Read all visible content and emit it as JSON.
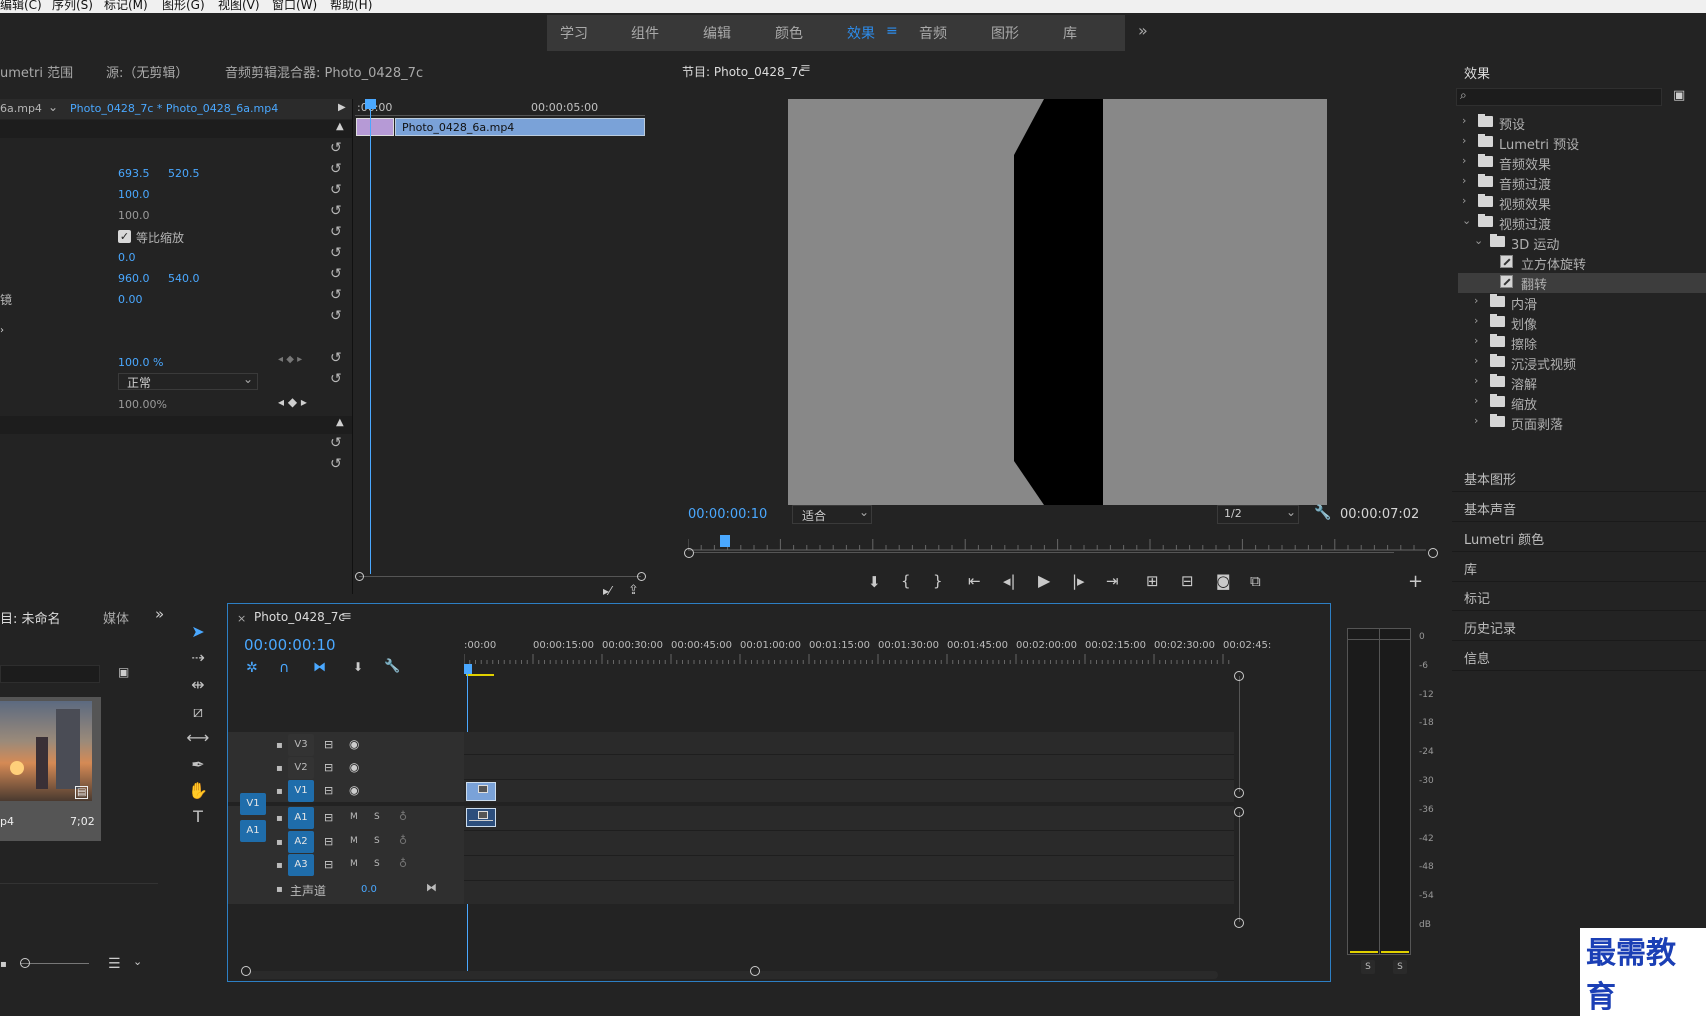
{
  "menu": [
    "编辑(C)",
    "序列(S)",
    "标记(M)",
    "图形(G)",
    "视图(V)",
    "窗口(W)",
    "帮助(H)"
  ],
  "workspaces": [
    {
      "label": "学习",
      "active": false
    },
    {
      "label": "组件",
      "active": false
    },
    {
      "label": "编辑",
      "active": false
    },
    {
      "label": "颜色",
      "active": false
    },
    {
      "label": "效果",
      "active": true
    },
    {
      "label": "音频",
      "active": false
    },
    {
      "label": "图形",
      "active": false
    },
    {
      "label": "库",
      "active": false
    }
  ],
  "workspace_more": "»",
  "workspace_menu_icon": "≡",
  "upper_left": {
    "tabs": [
      "umetri 范围",
      "源:（无剪辑）",
      "音频剪辑混合器: Photo_0428_7c"
    ],
    "clip_tab_left": "6a.mp4",
    "clip_tab_right": "Photo_0428_7c * Photo_0428_6a.mp4",
    "values": {
      "position_x": "693.5",
      "position_y": "520.5",
      "scale": "100.0",
      "scale_width": "100.0",
      "uniform_scale": "等比缩放",
      "rotation": "0.0",
      "anchor_x": "960.0",
      "anchor_y": "540.0",
      "flicker_label": "镜",
      "flicker": "0.00",
      "opacity": "100.0 %",
      "blend_mode": "正常",
      "time_remap": "100.00%"
    },
    "mini_timeline": {
      "t0": ":00:00",
      "t1": "00:00:05:00",
      "clip": "Photo_0428_6a.mp4"
    }
  },
  "program": {
    "title": "节目: Photo_0428_7c",
    "timecode": "00:00:00:10",
    "fit": "适合",
    "resolution": "1/2",
    "duration": "00:00:07:02"
  },
  "effects": {
    "title": "效果",
    "tree": [
      {
        "label": "预设",
        "level": 0,
        "type": "preset",
        "open": false
      },
      {
        "label": "Lumetri 预设",
        "level": 0,
        "type": "preset",
        "open": false
      },
      {
        "label": "音频效果",
        "level": 0,
        "type": "folder",
        "open": false
      },
      {
        "label": "音频过渡",
        "level": 0,
        "type": "folder",
        "open": false
      },
      {
        "label": "视频效果",
        "level": 0,
        "type": "folder",
        "open": false
      },
      {
        "label": "视频过渡",
        "level": 0,
        "type": "folder",
        "open": true
      },
      {
        "label": "3D 运动",
        "level": 1,
        "type": "folder",
        "open": true
      },
      {
        "label": "立方体旋转",
        "level": 2,
        "type": "effect",
        "open": false
      },
      {
        "label": "翻转",
        "level": 2,
        "type": "effect",
        "open": false,
        "selected": true
      },
      {
        "label": "内滑",
        "level": 1,
        "type": "folder",
        "open": false
      },
      {
        "label": "划像",
        "level": 1,
        "type": "folder",
        "open": false
      },
      {
        "label": "擦除",
        "level": 1,
        "type": "folder",
        "open": false
      },
      {
        "label": "沉浸式视频",
        "level": 1,
        "type": "folder",
        "open": false
      },
      {
        "label": "溶解",
        "level": 1,
        "type": "folder",
        "open": false
      },
      {
        "label": "缩放",
        "level": 1,
        "type": "folder",
        "open": false
      },
      {
        "label": "页面剥落",
        "level": 1,
        "type": "folder",
        "open": false
      }
    ],
    "sections": [
      "基本图形",
      "基本声音",
      "Lumetri 颜色",
      "库",
      "标记",
      "历史记录",
      "信息"
    ]
  },
  "project": {
    "tabs": [
      "目: 未命名",
      "媒体"
    ],
    "thumb_name": "p4",
    "thumb_duration": "7;02"
  },
  "timeline": {
    "tab": "Photo_0428_7c",
    "timecode": "00:00:00:10",
    "ruler": [
      ":00:00",
      "00:00:15:00",
      "00:00:30:00",
      "00:00:45:00",
      "00:01:00:00",
      "00:01:15:00",
      "00:01:30:00",
      "00:01:45:00",
      "00:02:00:00",
      "00:02:15:00",
      "00:02:30:00",
      "00:02:45:"
    ],
    "video_tracks": [
      "V3",
      "V2",
      "V1"
    ],
    "audio_tracks": [
      "A1",
      "A2",
      "A3"
    ],
    "source_v": "V1",
    "source_a": "A1",
    "m": "M",
    "s": "S",
    "master": "主声道",
    "master_value": "0.0"
  },
  "meter": {
    "scale": [
      "0",
      "-6",
      "-12",
      "-18",
      "-24",
      "-30",
      "-36",
      "-42",
      "-48",
      "-54",
      "dB"
    ],
    "solo": [
      "S",
      "S"
    ]
  },
  "watermark": "最需教育"
}
